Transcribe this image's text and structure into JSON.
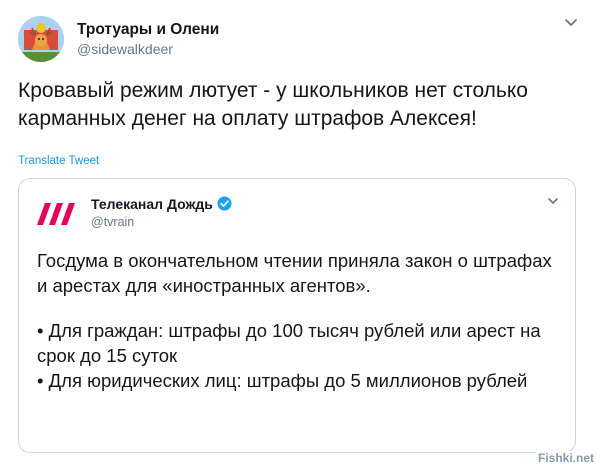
{
  "tweet": {
    "author_name": "Тротуары и Олени",
    "author_handle": "@sidewalkdeer",
    "text": "Кровавый режим лютует - у школьников нет столько карманных денег на оплату штрафов Алексея!",
    "translate_label": "Translate Tweet",
    "menu_icon": "chevron-down-icon",
    "avatar_icon": "deer-avatar"
  },
  "quoted_tweet": {
    "author_name": "Телеканал Дождь",
    "author_handle": "@tvrain",
    "verified": true,
    "logo_icon": "tvrain-logo",
    "menu_icon": "chevron-down-icon",
    "paragraph": "Госдума в окончательном чтении приняла закон о штрафах и арестах для «иностранных агентов».",
    "bullets": [
      "• Для граждан: штрафы до 100 тысяч рублей или арест на срок до 15 суток",
      "• Для юридических лиц: штрафы до 5 миллионов рублей"
    ]
  },
  "watermark": "Fishki.net",
  "colors": {
    "link": "#1b95e0",
    "secondary_text": "#657786",
    "border": "#ccd6dd",
    "verified": "#1da1f2",
    "tvrain_logo": "#e3005a"
  }
}
